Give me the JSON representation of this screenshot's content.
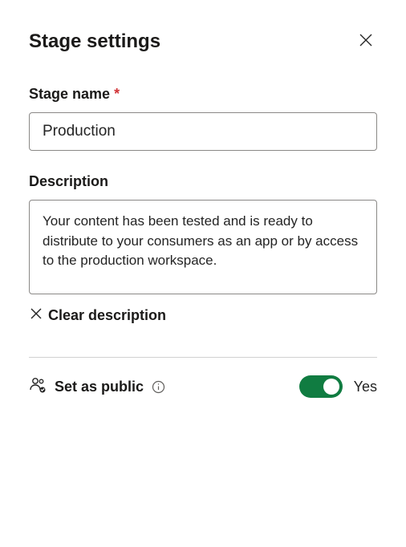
{
  "header": {
    "title": "Stage settings"
  },
  "fields": {
    "stage_name": {
      "label": "Stage name",
      "required_marker": "*",
      "value": "Production"
    },
    "description": {
      "label": "Description",
      "value": "Your content has been tested and is ready to distribute to your consumers as an app or by access to the production workspace.",
      "clear_label": "Clear description"
    }
  },
  "public": {
    "label": "Set as public",
    "toggle_value": "Yes",
    "toggle_on": true
  },
  "colors": {
    "accent": "#107c41",
    "required": "#d13438"
  }
}
